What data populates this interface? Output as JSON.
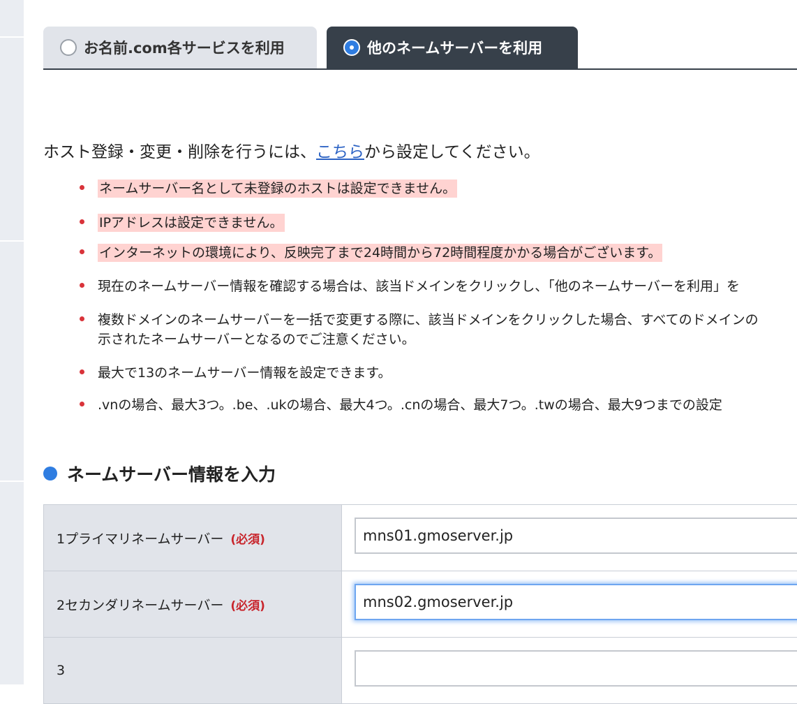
{
  "tabs": [
    {
      "label": "お名前.com各サービスを利用",
      "selected": false
    },
    {
      "label": "他のネームサーバーを利用",
      "selected": true
    }
  ],
  "intro": {
    "before_link": "ホスト登録・変更・削除を行うには、",
    "link_text": "こちら",
    "after_link": "から設定してください。"
  },
  "notes": [
    {
      "line1": "ネームサーバー名として未登録のホストは設定できません。",
      "highlighted": true
    },
    {
      "line1": "IPアドレスは設定できません。",
      "highlighted": true
    },
    {
      "line1": "インターネットの環境により、反映完了まで24時間から72時間程度かかる場合がございます。",
      "highlighted": true
    },
    {
      "line1": "現在のネームサーバー情報を確認する場合は、該当ドメインをクリックし、「他のネームサーバーを利用」を",
      "highlighted": false
    },
    {
      "line1": "複数ドメインのネームサーバーを一括で変更する際に、該当ドメインをクリックした場合、すべてのドメインの",
      "line2": "示されたネームサーバーとなるのでご注意ください。",
      "highlighted": false
    },
    {
      "line1": "最大で13のネームサーバー情報を設定できます。",
      "highlighted": false
    },
    {
      "line1": ".vnの場合、最大3つ。.be、.ukの場合、最大4つ。.cnの場合、最大7つ。.twの場合、最大9つまでの設定",
      "highlighted": false
    }
  ],
  "section": {
    "title": "ネームサーバー情報を入力"
  },
  "form": {
    "required_label": "(必須)",
    "rows": [
      {
        "label": "1プライマリネームサーバー",
        "required": true,
        "value": "mns01.gmoserver.jp"
      },
      {
        "label": "2セカンダリネームサーバー",
        "required": true,
        "value": "mns02.gmoserver.jp",
        "focused": true
      },
      {
        "label": "3",
        "required": false,
        "value": ""
      }
    ]
  },
  "colors": {
    "accent": "#2f7de1",
    "tab_active": "#37404a",
    "highlight": "#ffd3d1",
    "required": "#c8262d",
    "bullet": "#d9333a"
  }
}
